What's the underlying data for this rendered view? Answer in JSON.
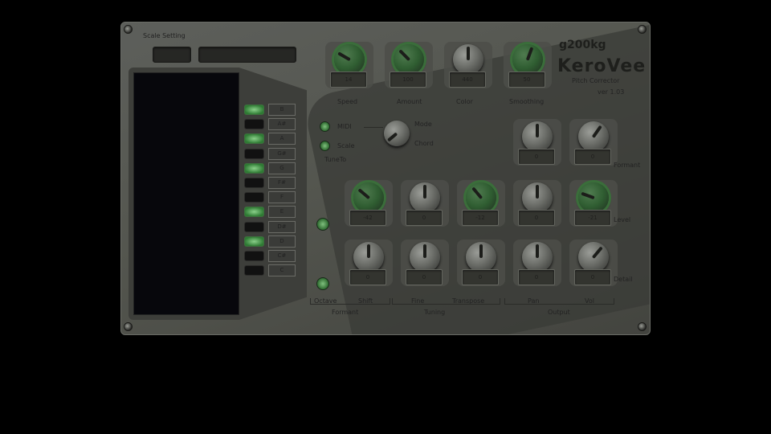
{
  "header": {
    "scale_setting_label": "Scale Setting",
    "brand_logo": "g200kg",
    "product_name": "KeroVee",
    "product_subtitle": "Pitch Corrector",
    "version": "ver 1.03"
  },
  "top_knobs": [
    {
      "label": "Speed",
      "value": "14",
      "active": true
    },
    {
      "label": "Amount",
      "value": "100",
      "active": true
    },
    {
      "label": "Color",
      "value": "440",
      "active": false
    },
    {
      "label": "Smoothing",
      "value": "50",
      "active": true
    }
  ],
  "mode_selector": {
    "mode_label": "Mode",
    "options": [
      {
        "label": "MIDI"
      },
      {
        "label": "Scale"
      }
    ],
    "tune_label": "TuneTo",
    "chord_label": "Chord"
  },
  "keys": [
    {
      "label": "B",
      "on": true
    },
    {
      "label": "A#",
      "on": false
    },
    {
      "label": "A",
      "on": true
    },
    {
      "label": "G#",
      "on": false
    },
    {
      "label": "G",
      "on": true
    },
    {
      "label": "F#",
      "on": false
    },
    {
      "label": "F",
      "on": false
    },
    {
      "label": "E",
      "on": true
    },
    {
      "label": "D#",
      "on": false
    },
    {
      "label": "D",
      "on": true
    },
    {
      "label": "C#",
      "on": false
    },
    {
      "label": "C",
      "on": false
    }
  ],
  "formant_knobs": {
    "label": "Formant",
    "items": [
      {
        "value": "0"
      },
      {
        "value": "0"
      }
    ]
  },
  "rows": [
    {
      "row_label": "Level",
      "knobs": [
        {
          "value": "-42",
          "active": true
        },
        {
          "value": "0",
          "active": false
        },
        {
          "value": "-12",
          "active": true
        },
        {
          "value": "0",
          "active": false
        },
        {
          "value": "-21",
          "active": true
        }
      ]
    },
    {
      "row_label": "Detail",
      "knobs": [
        {
          "value": "0",
          "active": false
        },
        {
          "value": "0",
          "active": false
        },
        {
          "value": "0",
          "active": false
        },
        {
          "value": "0",
          "active": false
        },
        {
          "value": "0",
          "active": false
        }
      ]
    }
  ],
  "bottom_labels": {
    "octave": "Octave",
    "shift": "Shift",
    "fine": "Fine",
    "transpose": "Transpose",
    "pan": "Pan",
    "vol": "Vol",
    "formant": "Formant",
    "tuning": "Tuning",
    "output": "Output"
  }
}
